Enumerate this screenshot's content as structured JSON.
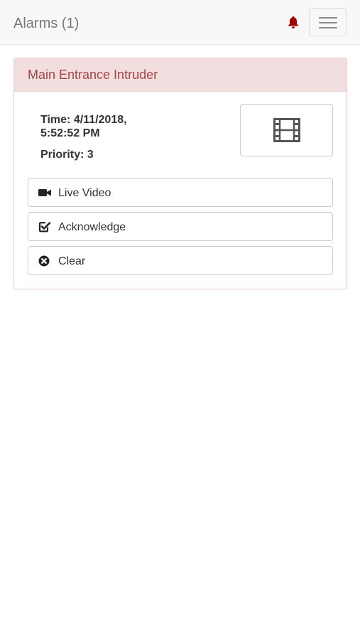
{
  "navbar": {
    "title": "Alarms (1)",
    "bell_icon": "bell-icon",
    "bell_color": "#a00000",
    "menu_icon": "hamburger-menu-icon"
  },
  "alarm": {
    "title": "Main Entrance Intruder",
    "time_line1": "Time: 4/11/2018,",
    "time_line2": "5:52:52 PM",
    "priority": "Priority: 3",
    "thumbnail_icon": "film-icon",
    "accent_color": "#a94442",
    "heading_bg": "#f2dede",
    "actions": [
      {
        "label": "Live Video",
        "icon": "video-camera-icon"
      },
      {
        "label": "Acknowledge",
        "icon": "checkbox-checked-icon"
      },
      {
        "label": "Clear",
        "icon": "times-circle-icon"
      }
    ]
  }
}
